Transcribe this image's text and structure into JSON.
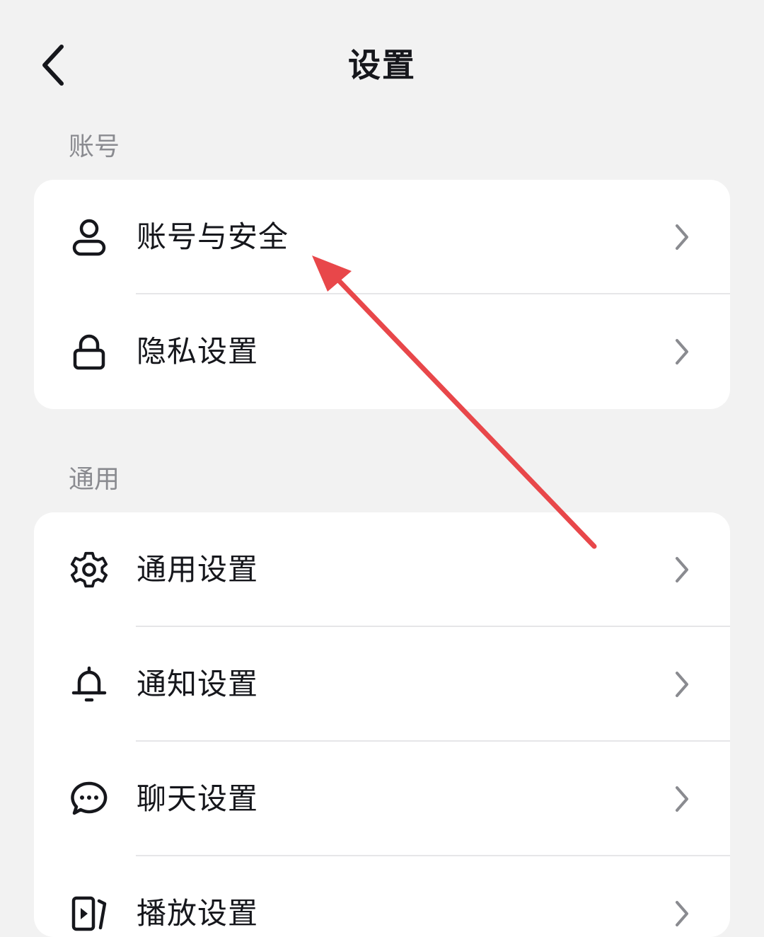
{
  "header": {
    "title": "设置",
    "back_icon": "chevron-left-icon"
  },
  "sections": [
    {
      "label": "账号",
      "items": [
        {
          "label": "账号与安全",
          "icon": "user-icon"
        },
        {
          "label": "隐私设置",
          "icon": "lock-icon"
        }
      ]
    },
    {
      "label": "通用",
      "items": [
        {
          "label": "通用设置",
          "icon": "gear-icon"
        },
        {
          "label": "通知设置",
          "icon": "bell-icon"
        },
        {
          "label": "聊天设置",
          "icon": "chat-icon"
        },
        {
          "label": "播放设置",
          "icon": "play-icon"
        }
      ]
    }
  ],
  "colors": {
    "background": "#f2f2f2",
    "card": "#ffffff",
    "text": "#16171c",
    "section_label": "#8a8b90",
    "chevron": "#8a8b90",
    "annotation_arrow": "#e8474a"
  }
}
